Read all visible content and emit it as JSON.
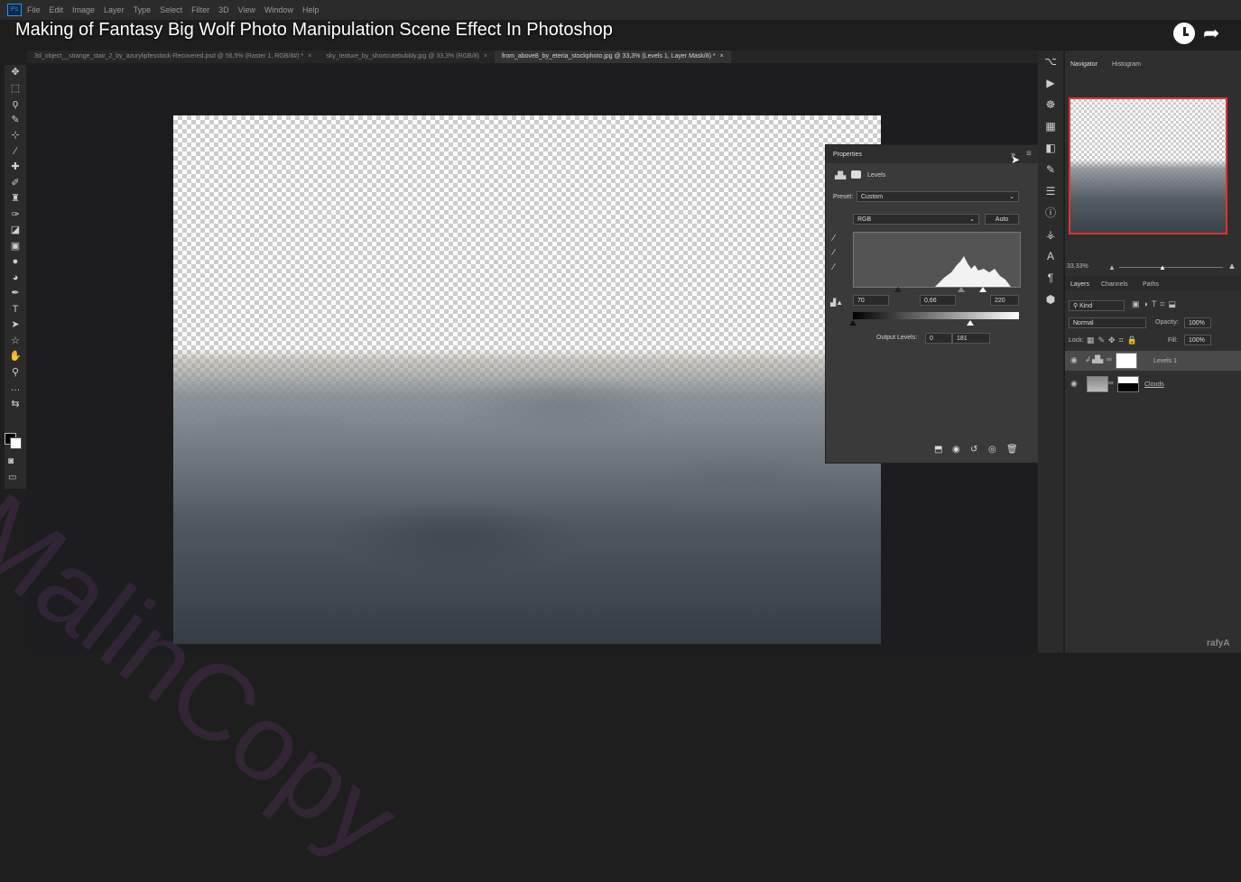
{
  "menu": [
    "File",
    "Edit",
    "Image",
    "Layer",
    "Type",
    "Select",
    "Filter",
    "3D",
    "View",
    "Window",
    "Help"
  ],
  "ps_logo": "Ps",
  "video": {
    "title": "Making of Fantasy Big Wolf Photo Manipulation Scene Effect In Photoshop"
  },
  "tabs": [
    {
      "label": "3d_object__strange_stair_2_by_azurylipfesstock-Recovered.psd @ 56,5% (Raster 1, RGB/8#) *",
      "active": false
    },
    {
      "label": "sky_texture_by_shortcutebubbly.jpg @ 33,3% (RGB/8)",
      "active": false
    },
    {
      "label": "from_above8_by_eteria_stockphoto.jpg @ 33,3% (Levels 1, Layer Mask/8) *",
      "active": true
    }
  ],
  "tab_close": "×",
  "properties": {
    "title": "Properties",
    "expand": "»",
    "menu": "≡",
    "adjustment": "Levels",
    "preset_label": "Preset:",
    "preset_value": "Custom",
    "channel": "RGB",
    "auto_label": "Auto",
    "input_black": "70",
    "input_gamma": "0,66",
    "input_white": "220",
    "output_label": "Output Levels:",
    "output_black": "0",
    "output_white": "181"
  },
  "navigator": {
    "tab": "Navigator",
    "tab2": "Histogram",
    "zoom": "33,33%"
  },
  "layers_panel": {
    "tabs": [
      "Layers",
      "Channels",
      "Paths"
    ],
    "kind": "Kind",
    "blend_mode": "Normal",
    "opacity_label": "Opacity:",
    "opacity_value": "100%",
    "lock_label": "Lock:",
    "fill_label": "Fill:",
    "fill_value": "100%",
    "layers": [
      {
        "name": "Levels 1",
        "selected": true
      },
      {
        "name": "Clouds",
        "selected": false
      }
    ]
  },
  "watermark": "MalinCopy",
  "corner_brand": "rafyA"
}
